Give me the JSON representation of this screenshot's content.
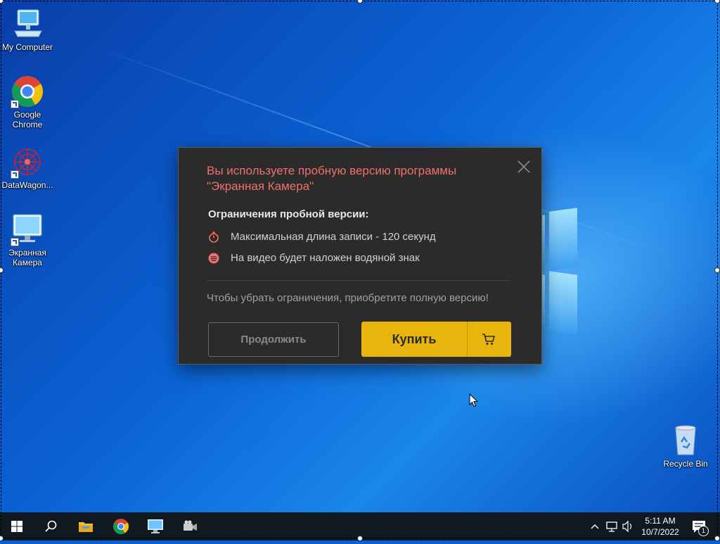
{
  "desktop": {
    "icons": [
      {
        "label": "My Computer"
      },
      {
        "label": "Google Chrome"
      },
      {
        "label": "DataWagon..."
      },
      {
        "label": "Экранная Камера"
      },
      {
        "label": "Recycle Bin"
      }
    ]
  },
  "dialog": {
    "title_line1": "Вы используете пробную версию программы",
    "title_line2": "\"Экранная Камера\"",
    "subtitle": "Ограничения пробной версии:",
    "limits": [
      {
        "icon": "stopwatch-icon",
        "text": "Максимальная длина записи - 120 секунд"
      },
      {
        "icon": "watermark-icon",
        "text": "На видео будет наложен водяной знак"
      }
    ],
    "hint": "Чтобы убрать ограничения, приобретите полную версию!",
    "continue_label": "Продолжить",
    "buy_label": "Купить",
    "accent_color": "#e8b50c",
    "title_color": "#f0706a"
  },
  "taskbar": {
    "time": "5:11 AM",
    "date": "10/7/2022",
    "notification_count": "1"
  }
}
